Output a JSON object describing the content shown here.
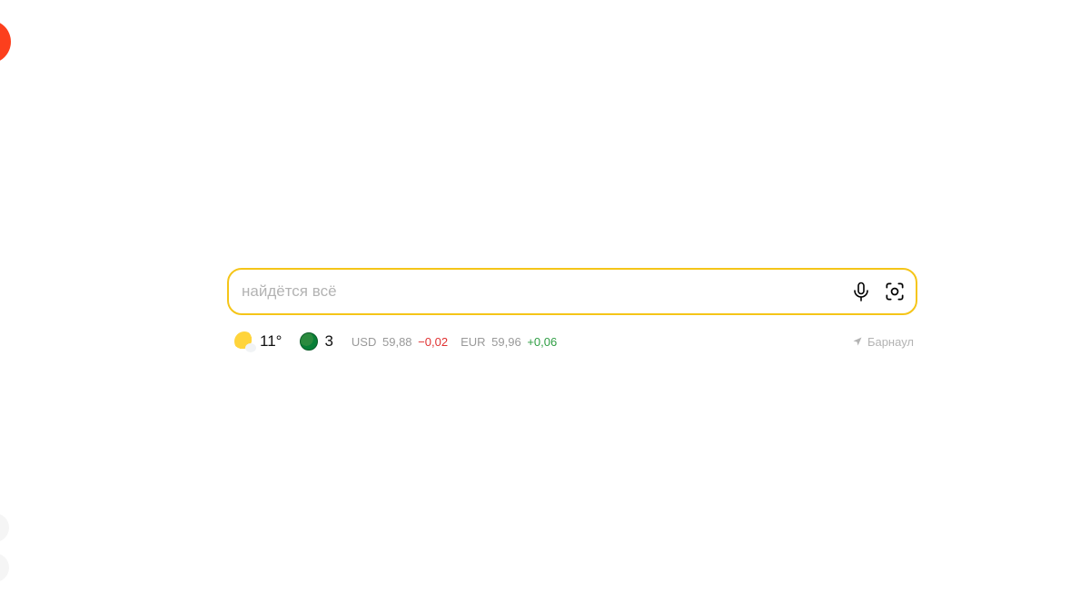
{
  "search": {
    "placeholder": "найдётся всё",
    "value": ""
  },
  "weather": {
    "temperature": "11°"
  },
  "traffic": {
    "level": "3"
  },
  "rates": {
    "usd": {
      "label": "USD",
      "value": "59,88",
      "delta": "−0,02"
    },
    "eur": {
      "label": "EUR",
      "value": "59,96",
      "delta": "+0,06"
    }
  },
  "location": {
    "city": "Барнаул"
  }
}
